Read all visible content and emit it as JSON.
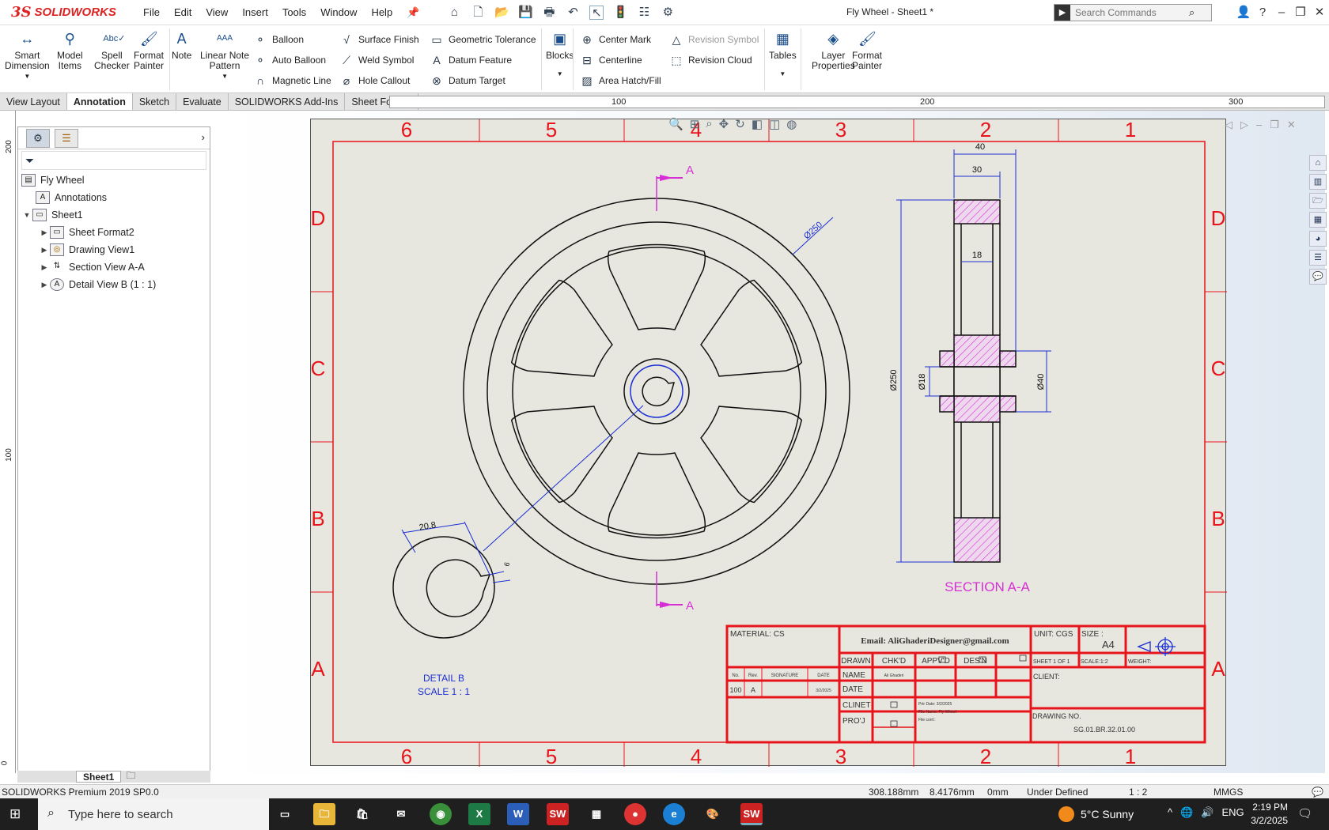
{
  "app": {
    "logo_ds": "3S",
    "logo_name": "SOLIDWORKS",
    "menu": [
      "File",
      "Edit",
      "View",
      "Insert",
      "Tools",
      "Window",
      "Help"
    ],
    "document_title": "Fly Wheel - Sheet1 *",
    "search_placeholder": "Search Commands"
  },
  "ribbon": {
    "big_buttons": [
      {
        "label1": "Smart",
        "label2": "Dimension",
        "icon": "smart-dimension-icon"
      },
      {
        "label1": "Model",
        "label2": "Items",
        "icon": "model-items-icon"
      },
      {
        "label1": "Spell",
        "label2": "Checker",
        "icon": "spell-checker-icon"
      },
      {
        "label1": "Format",
        "label2": "Painter",
        "icon": "format-painter-icon"
      },
      {
        "label1": "Note",
        "label2": "",
        "icon": "note-icon"
      },
      {
        "label1": "Linear Note",
        "label2": "Pattern",
        "icon": "linear-note-pattern-icon"
      }
    ],
    "col1": [
      "Balloon",
      "Auto Balloon",
      "Magnetic Line"
    ],
    "col2": [
      "Surface Finish",
      "Weld Symbol",
      "Hole Callout"
    ],
    "col3": [
      "Geometric Tolerance",
      "Datum Feature",
      "Datum Target"
    ],
    "blocks": "Blocks",
    "col4": [
      "Center Mark",
      "Centerline",
      "Area Hatch/Fill"
    ],
    "col5": [
      "Revision Symbol",
      "Revision Cloud"
    ],
    "tables": "Tables",
    "layer1": "Layer",
    "layer2": "Properties",
    "fp1": "Format",
    "fp2": "Painter"
  },
  "tabs": [
    "View Layout",
    "Annotation",
    "Sketch",
    "Evaluate",
    "SOLIDWORKS Add-Ins",
    "Sheet Format"
  ],
  "active_tab": "Annotation",
  "ruler": {
    "top": [
      "100",
      "200",
      "300"
    ],
    "left": [
      "200",
      "100",
      "0"
    ]
  },
  "tree": {
    "root": "Fly Wheel",
    "items": [
      {
        "label": "Annotations",
        "level": 1,
        "expander": ""
      },
      {
        "label": "Sheet1",
        "level": 0,
        "expander": "▼"
      },
      {
        "label": "Sheet Format2",
        "level": 2,
        "expander": "▶"
      },
      {
        "label": "Drawing View1",
        "level": 2,
        "expander": "▶"
      },
      {
        "label": "Section View A-A",
        "level": 2,
        "expander": "▶"
      },
      {
        "label": "Detail View B (1 : 1)",
        "level": 2,
        "expander": "▶"
      }
    ]
  },
  "sheet_tab": "Sheet1",
  "drawing": {
    "zone_cols": [
      "6",
      "5",
      "4",
      "3",
      "2",
      "1"
    ],
    "zone_rows": [
      "D",
      "C",
      "B",
      "A"
    ],
    "dims": {
      "dia250": "Ø250",
      "w40": "40",
      "w30": "30",
      "w18": "18",
      "h250": "Ø250",
      "h18": "Ø18",
      "h40": "Ø40",
      "detail_w": "20.8",
      "detail_k": "6"
    },
    "section_letter": "A",
    "section_title": "SECTION A-A",
    "detail_title": "DETAIL B",
    "detail_scale": "SCALE 1 : 1"
  },
  "title_block": {
    "material": "MATERIAL:   CS",
    "email": "Email: AliGhaderiDesigner@gmail.com",
    "unit": "UNIT: CGS",
    "size": "SIZE :",
    "size_val": "A4",
    "drawn": "DRAWN",
    "chkd": "CHK'D",
    "appvd": "APPV'D",
    "desn": "DES'N",
    "sheet": "SHEET 1 OF 1",
    "scale": "SCALE:1:2",
    "weight": "WEIGHT:",
    "no": "No.",
    "rev": "Rev.",
    "signature": "SIGNATURE",
    "date_hdr": "DATE",
    "name": "NAME",
    "name_val": "Ali Ghaderi",
    "date": "DATE",
    "rev_no": "100",
    "rev_letter": "A",
    "rev_date": "3/2/2025",
    "client": "CLIENT:",
    "clinet": "CLINET",
    "proj": "PRO'J",
    "print_date": "Prtr Date:  3/2/2025",
    "file_name": "File Name:  Fly Wheel",
    "file_conf": "File conf.:",
    "drawing_no": "DRAWING NO.",
    "drawing_no_val": "SG.01.BR.32.01.00"
  },
  "status": {
    "product": "SOLIDWORKS Premium 2019 SP0.0",
    "x": "308.188mm",
    "y": "8.4176mm",
    "z": "0mm",
    "state": "Under Defined",
    "scale": "1 : 2",
    "units": "MMGS"
  },
  "taskbar": {
    "search": "Type here to search",
    "weather": "5°C  Sunny",
    "lang": "ENG",
    "time": "2:19 PM",
    "date": "3/2/2025"
  },
  "colors": {
    "border_red": "#e8141c",
    "section_magenta": "#d62fd6",
    "view_blue": "#1a2fd6"
  }
}
